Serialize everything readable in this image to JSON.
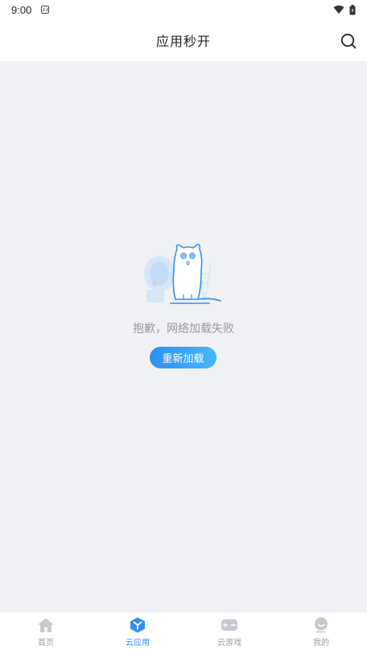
{
  "status_bar": {
    "time": "9:00"
  },
  "header": {
    "title": "应用秒开"
  },
  "content": {
    "error_message": "抱歉，网络加载失败",
    "reload_label": "重新加载"
  },
  "tab_bar": {
    "items": [
      {
        "label": "首页",
        "icon": "home-icon",
        "active": false
      },
      {
        "label": "云应用",
        "icon": "cloud-app-icon",
        "active": true
      },
      {
        "label": "云游戏",
        "icon": "gamepad-icon",
        "active": false
      },
      {
        "label": "我的",
        "icon": "profile-icon",
        "active": false
      }
    ]
  },
  "colors": {
    "accent": "#2f8ff0",
    "background": "#f0f1f4",
    "inactive": "#9a9a9a"
  }
}
